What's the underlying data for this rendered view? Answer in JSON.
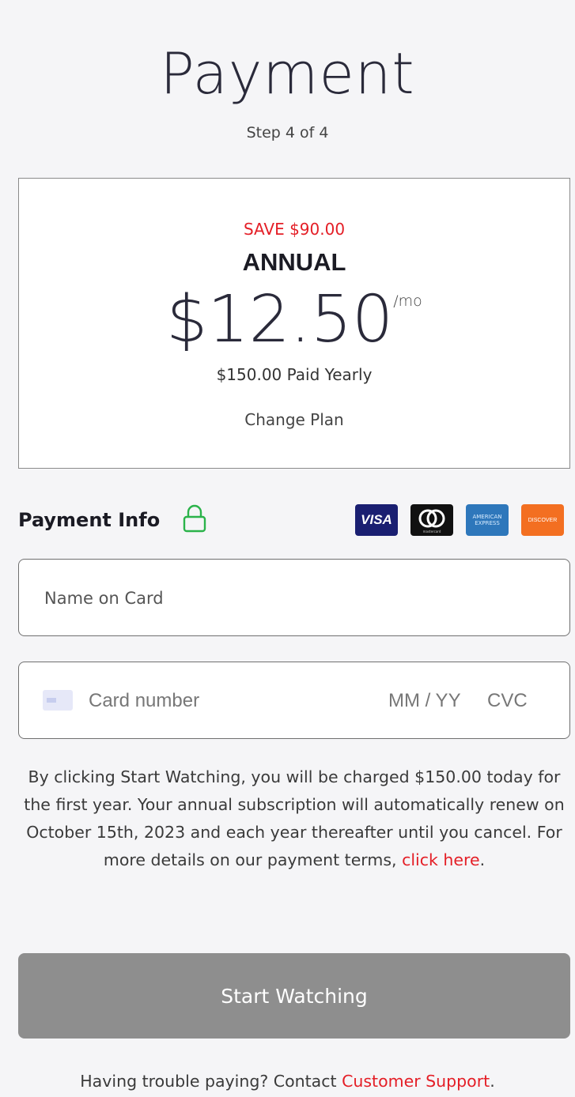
{
  "header": {
    "title": "Payment",
    "step": "Step 4 of 4"
  },
  "plan": {
    "save": "SAVE $90.00",
    "name": "ANNUAL",
    "price": "$12.50",
    "per": "/mo",
    "billing": "$150.00 Paid Yearly",
    "change_label": "Change Plan"
  },
  "payment_info": {
    "title": "Payment Info",
    "cards": {
      "visa": "VISA",
      "mastercard_text": "mastercard",
      "amex_text": "AMERICAN EXPRESS",
      "discover": "DISCOVER"
    }
  },
  "form": {
    "name_placeholder": "Name on Card",
    "card_placeholder": "Card number",
    "exp_placeholder": "MM / YY",
    "cvc_placeholder": "CVC"
  },
  "terms": {
    "text": "By clicking Start Watching, you will be charged $150.00 today for the first year. Your annual subscription will automatically renew on October 15th, 2023 and each year thereafter until you cancel. For more details on our payment terms, ",
    "link": "click here",
    "end": "."
  },
  "cta": {
    "label": "Start Watching"
  },
  "help": {
    "text": "Having trouble paying? Contact ",
    "link": "Customer Support",
    "end": "."
  },
  "colors": {
    "accent_red": "#e41e26",
    "lock_green": "#2bb34a",
    "button_gray": "#8e8e8e"
  }
}
